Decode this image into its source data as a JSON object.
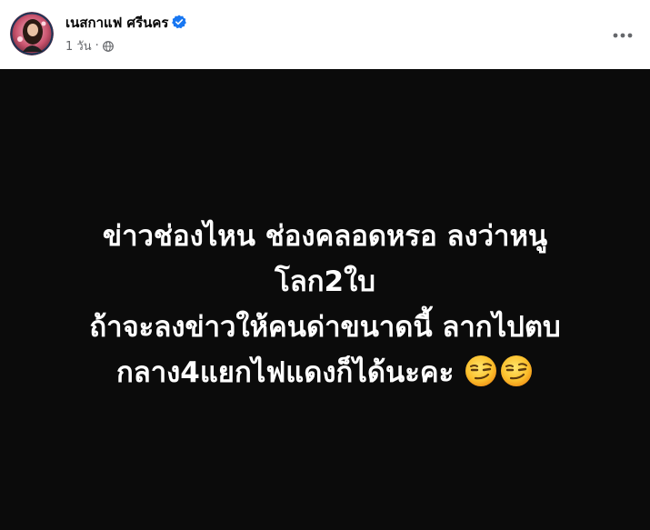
{
  "post": {
    "author": "เนสกาแฟ ศรีนคร",
    "time": "1 วัน",
    "separator": "·",
    "audience_icon": "globe-icon",
    "verified_icon": "verified-badge-icon",
    "menu_icon": "more-options-icon",
    "text_lines": [
      "ข่าวช่องไหน ช่องคลอดหรอ ลงว่าหนู",
      "โลก2ใบ",
      "ถ้าจะลงข่าวให้คนด่าขนาดนี้ ลากไปตบ",
      "กลาง4แยกไฟแดงก็ได้นะคะ"
    ],
    "emojis": [
      "smirking-face-emoji",
      "smirking-face-emoji"
    ],
    "colors": {
      "background": "#0b0b0b",
      "text": "#ffffff",
      "verified": "#1877f2",
      "meta": "#65676b"
    }
  }
}
